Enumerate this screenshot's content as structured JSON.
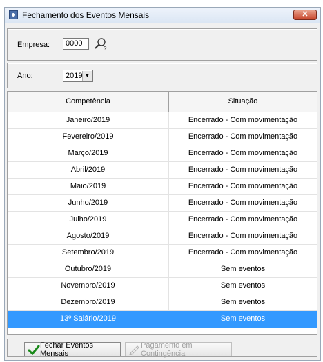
{
  "window": {
    "title": "Fechamento dos Eventos Mensais",
    "close_label": "✕"
  },
  "empresa": {
    "label": "Empresa:",
    "value": "0000"
  },
  "ano": {
    "label": "Ano:",
    "value": "2019"
  },
  "grid": {
    "headers": [
      "Competência",
      "Situação"
    ],
    "rows": [
      [
        "Janeiro/2019",
        "Encerrado - Com movimentação"
      ],
      [
        "Fevereiro/2019",
        "Encerrado - Com movimentação"
      ],
      [
        "Março/2019",
        "Encerrado - Com movimentação"
      ],
      [
        "Abril/2019",
        "Encerrado - Com movimentação"
      ],
      [
        "Maio/2019",
        "Encerrado - Com movimentação"
      ],
      [
        "Junho/2019",
        "Encerrado - Com movimentação"
      ],
      [
        "Julho/2019",
        "Encerrado - Com movimentação"
      ],
      [
        "Agosto/2019",
        "Encerrado - Com movimentação"
      ],
      [
        "Setembro/2019",
        "Encerrado - Com movimentação"
      ],
      [
        "Outubro/2019",
        "Sem eventos"
      ],
      [
        "Novembro/2019",
        "Sem eventos"
      ],
      [
        "Dezembro/2019",
        "Sem eventos"
      ],
      [
        "13º Salário/2019",
        "Sem eventos"
      ]
    ],
    "selected_row": 12
  },
  "buttons": {
    "fechar": "Fechar Eventos Mensais",
    "pagamento": "Pagamento em Contingência"
  },
  "colors": {
    "selection": "#3399ff",
    "check": "#1a8a1a"
  }
}
